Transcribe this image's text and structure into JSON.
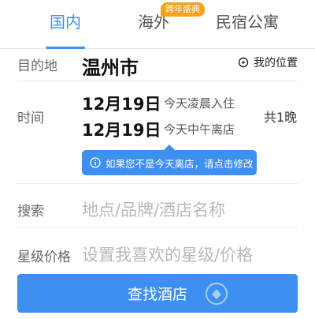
{
  "tabs": [
    {
      "label": "国内",
      "active": true
    },
    {
      "label": "海外",
      "active": false
    },
    {
      "label": "民宿公寓",
      "active": false
    }
  ],
  "promo_badge": "跨年盛典",
  "destination": {
    "label": "目的地",
    "city": "温州市",
    "my_location": "我的位置"
  },
  "time": {
    "label": "时间",
    "checkin_date": "12月19日",
    "checkin_note": "今天凌晨入住",
    "checkout_date": "12月19日",
    "checkout_note": "今天中午离店",
    "nights": "共1晚"
  },
  "tooltip": "如果您不是今天离店，请点击修改",
  "search": {
    "label": "搜索",
    "placeholder": "地点/品牌/酒店名称"
  },
  "star_price": {
    "label": "星级价格",
    "placeholder": "设置我喜欢的星级/价格"
  },
  "search_button": "查找酒店",
  "colors": {
    "accent": "#3d8ff0",
    "badge": "#f6a21b"
  }
}
